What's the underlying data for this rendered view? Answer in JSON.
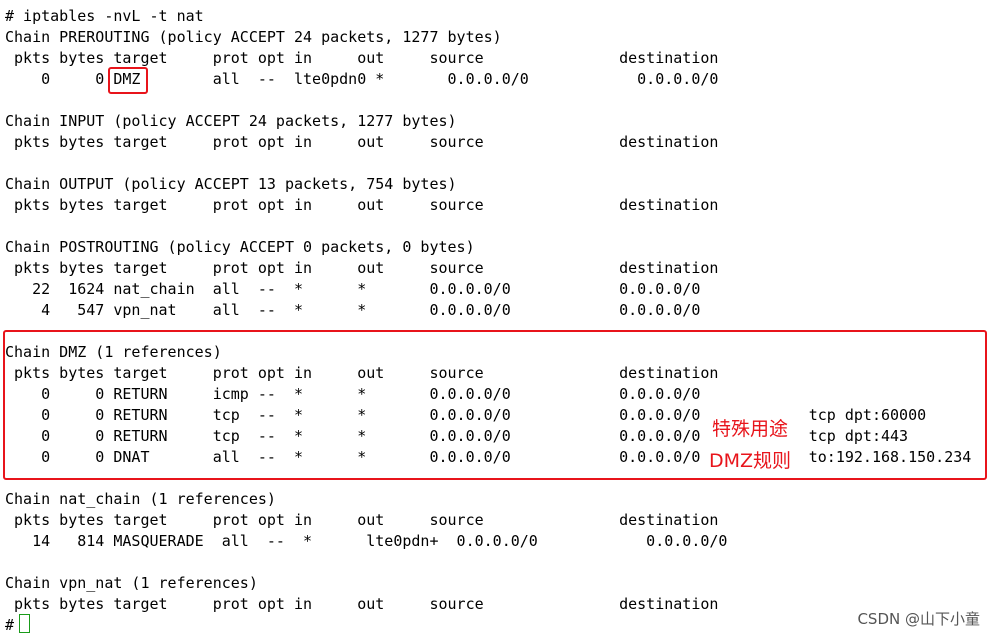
{
  "terminal": {
    "lines": [
      "# iptables -nvL -t nat",
      "Chain PREROUTING (policy ACCEPT 24 packets, 1277 bytes)",
      " pkts bytes target     prot opt in     out     source               destination",
      "    0     0 DMZ        all  --  lte0pdn0 *       0.0.0.0/0            0.0.0.0/0",
      "",
      "Chain INPUT (policy ACCEPT 24 packets, 1277 bytes)",
      " pkts bytes target     prot opt in     out     source               destination",
      "",
      "Chain OUTPUT (policy ACCEPT 13 packets, 754 bytes)",
      " pkts bytes target     prot opt in     out     source               destination",
      "",
      "Chain POSTROUTING (policy ACCEPT 0 packets, 0 bytes)",
      " pkts bytes target     prot opt in     out     source               destination",
      "   22  1624 nat_chain  all  --  *      *       0.0.0.0/0            0.0.0.0/0",
      "    4   547 vpn_nat    all  --  *      *       0.0.0.0/0            0.0.0.0/0",
      "",
      "Chain DMZ (1 references)",
      " pkts bytes target     prot opt in     out     source               destination",
      "    0     0 RETURN     icmp --  *      *       0.0.0.0/0            0.0.0.0/0",
      "    0     0 RETURN     tcp  --  *      *       0.0.0.0/0            0.0.0.0/0            tcp dpt:60000",
      "    0     0 RETURN     tcp  --  *      *       0.0.0.0/0            0.0.0.0/0            tcp dpt:443",
      "    0     0 DNAT       all  --  *      *       0.0.0.0/0            0.0.0.0/0            to:192.168.150.234",
      "",
      "Chain nat_chain (1 references)",
      " pkts bytes target     prot opt in     out     source               destination",
      "   14   814 MASQUERADE  all  --  *      lte0pdn+  0.0.0.0/0            0.0.0.0/0",
      "",
      "Chain vpn_nat (1 references)",
      " pkts bytes target     prot opt in     out     source               destination",
      "#"
    ]
  },
  "annotations": {
    "line1": "特殊用途",
    "line2": "DMZ规则"
  },
  "watermark": "CSDN @山下小童",
  "colors": {
    "highlight": "#e8141b",
    "cursor": "#1a9b1a"
  }
}
